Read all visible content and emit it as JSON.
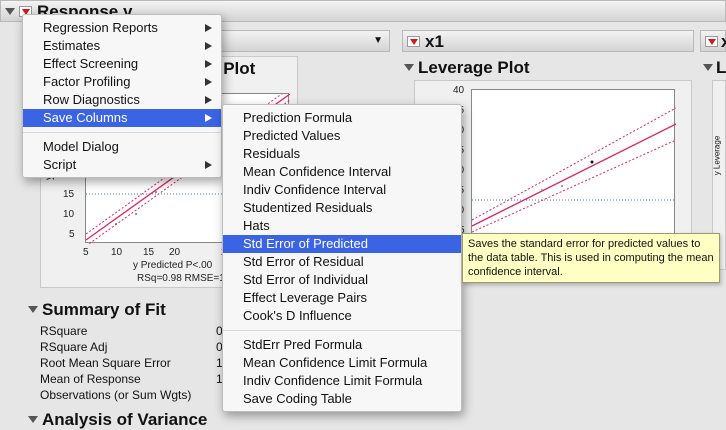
{
  "window": {
    "response_title": "Response y",
    "pred_plot_title": "Predicted Plot",
    "x1_section_title": "x1",
    "leverage_plot_title": "Leverage Plot",
    "right_section_title": "x",
    "right_plot_title": "L"
  },
  "pred_plot": {
    "x_ticks": [
      "5",
      "10",
      "15",
      "20",
      "2"
    ],
    "y_ticks": [
      "15",
      "10",
      "5"
    ],
    "y_axis_label": "y",
    "x_axis_label": "y Predicted P<.00",
    "stats": "RSq=0.98 RMSE=1.2"
  },
  "leverage_plot": {
    "y_ticks": [
      "40",
      "35",
      "30",
      "25",
      "20",
      "15",
      "10",
      "5"
    ],
    "right_axis_label": "y Leverage"
  },
  "summary_of_fit": {
    "title": "Summary of Fit",
    "rows": [
      {
        "label": "RSquare",
        "value": "0"
      },
      {
        "label": "RSquare Adj",
        "value": "0"
      },
      {
        "label": "Root Mean Square Error",
        "value": "1"
      },
      {
        "label": "Mean of Response",
        "value": "1"
      },
      {
        "label": "Observations (or Sum Wgts)",
        "value": ""
      }
    ]
  },
  "analysis_of_variance": {
    "title": "Analysis of Variance"
  },
  "main_menu": {
    "items": [
      {
        "label": "Regression Reports",
        "submenu": true
      },
      {
        "label": "Estimates",
        "submenu": true
      },
      {
        "label": "Effect Screening",
        "submenu": true
      },
      {
        "label": "Factor Profiling",
        "submenu": true
      },
      {
        "label": "Row Diagnostics",
        "submenu": true
      },
      {
        "label": "Save Columns",
        "submenu": true,
        "selected": true
      },
      {
        "label": "Model Dialog",
        "submenu": false
      },
      {
        "label": "Script",
        "submenu": true
      }
    ]
  },
  "save_columns_menu": {
    "items": [
      {
        "label": "Prediction Formula"
      },
      {
        "label": "Predicted Values"
      },
      {
        "label": "Residuals"
      },
      {
        "label": "Mean Confidence Interval"
      },
      {
        "label": "Indiv Confidence Interval"
      },
      {
        "label": "Studentized Residuals"
      },
      {
        "label": "Hats"
      },
      {
        "label": "Std Error of Predicted",
        "selected": true
      },
      {
        "label": "Std Error of Residual"
      },
      {
        "label": "Std Error of Individual"
      },
      {
        "label": "Effect Leverage Pairs"
      },
      {
        "label": "Cook's D Influence"
      },
      {
        "label": "StdErr Pred Formula"
      },
      {
        "label": "Mean Confidence Limit Formula"
      },
      {
        "label": "Indiv Confidence Limit Formula"
      },
      {
        "label": "Save Coding Table"
      }
    ]
  },
  "tooltip": {
    "text": "Saves the standard error for predicted values to the data table. This is used in computing the mean confidence interval."
  },
  "colors": {
    "fit_line": "#e0245e",
    "menu_highlight": "#3b64e4",
    "tooltip_bg": "#ffffc4"
  }
}
